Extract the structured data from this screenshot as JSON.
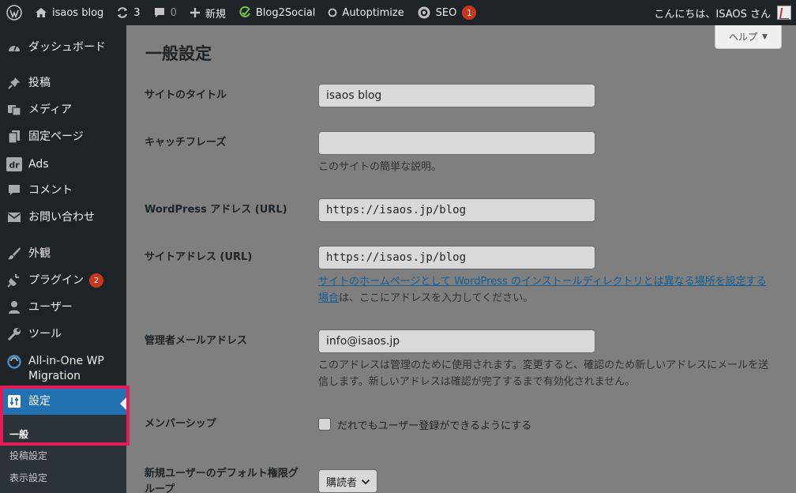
{
  "admin_bar": {
    "site_name": "isaos blog",
    "updates_count": "3",
    "comments_count": "0",
    "new_label": "新規",
    "blog2social_label": "Blog2Social",
    "autoptimize_label": "Autoptimize",
    "seo_label": "SEO",
    "seo_badge": "1",
    "greeting": "こんにちは、ISAOS さん"
  },
  "sidebar": {
    "items": [
      {
        "label": "ダッシュボード"
      },
      {
        "label": "投稿"
      },
      {
        "label": "メディア"
      },
      {
        "label": "固定ページ"
      },
      {
        "label": "Ads"
      },
      {
        "label": "コメント"
      },
      {
        "label": "お問い合わせ"
      },
      {
        "label": "外観"
      },
      {
        "label": "プラグイン",
        "badge": "2"
      },
      {
        "label": "ユーザー"
      },
      {
        "label": "ツール"
      },
      {
        "label": "All-in-One WP Migration"
      },
      {
        "label": "設定"
      }
    ],
    "submenu": [
      "一般",
      "投稿設定",
      "表示設定"
    ]
  },
  "main": {
    "title": "一般設定",
    "help_label": "ヘルプ",
    "fields": {
      "site_title": {
        "label": "サイトのタイトル",
        "value": "isaos blog"
      },
      "tagline": {
        "label": "キャッチフレーズ",
        "value": "",
        "description": "このサイトの簡単な説明。"
      },
      "wp_address": {
        "label": "WordPress アドレス (URL)",
        "value": "https://isaos.jp/blog"
      },
      "site_address": {
        "label": "サイトアドレス (URL)",
        "value": "https://isaos.jp/blog",
        "desc_link_1": "サイトのホームページとして WordPress のインストールディレクトリとは異なる場所を設定する",
        "desc_link_2": "場合",
        "desc_text": "は、ここにアドレスを入力してください。"
      },
      "admin_email": {
        "label": "管理者メールアドレス",
        "value": "info@isaos.jp",
        "desc_line_1": "このアドレスは管理のために使用されます。変更すると、確認のため新しいアドレスにメールを送",
        "desc_line_2": "信します。新しいアドレスは確認が完了するまで有効化されません。"
      },
      "membership": {
        "label": "メンバーシップ",
        "checkbox_label": "だれでもユーザー登録ができるようにする",
        "checked": false
      },
      "default_role": {
        "label_line_1": "新規ユーザーのデフォルト権限グ",
        "label_line_2": "ループ",
        "value": "購読者"
      }
    }
  }
}
